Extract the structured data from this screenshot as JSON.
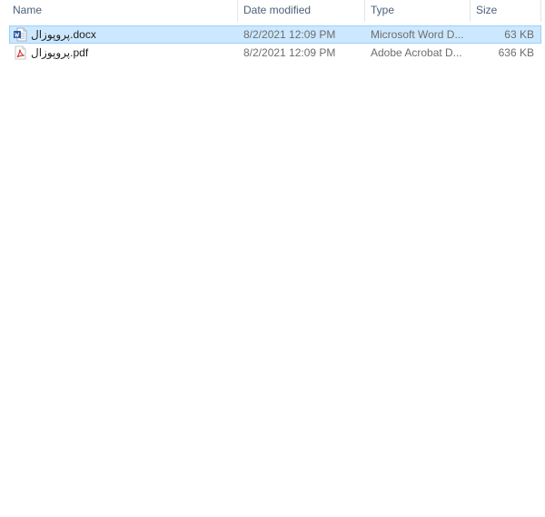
{
  "columns": {
    "name": "Name",
    "date_modified": "Date modified",
    "type": "Type",
    "size": "Size"
  },
  "sort_indicator": "˄",
  "files": [
    {
      "name": "پروپوزال.docx",
      "date_modified": "8/2/2021 12:09 PM",
      "type": "Microsoft Word D...",
      "size": "63 KB",
      "icon": "word-document-icon",
      "selected": true
    },
    {
      "name": "پروپوزال.pdf",
      "date_modified": "8/2/2021 12:09 PM",
      "type": "Adobe Acrobat D...",
      "size": "636 KB",
      "icon": "pdf-document-icon",
      "selected": false
    }
  ],
  "colors": {
    "selection_bg": "#cce8ff",
    "selection_border": "#99d1ff",
    "header_text": "#4c607a",
    "word_blue": "#2b579a",
    "pdf_red": "#d0312d"
  }
}
